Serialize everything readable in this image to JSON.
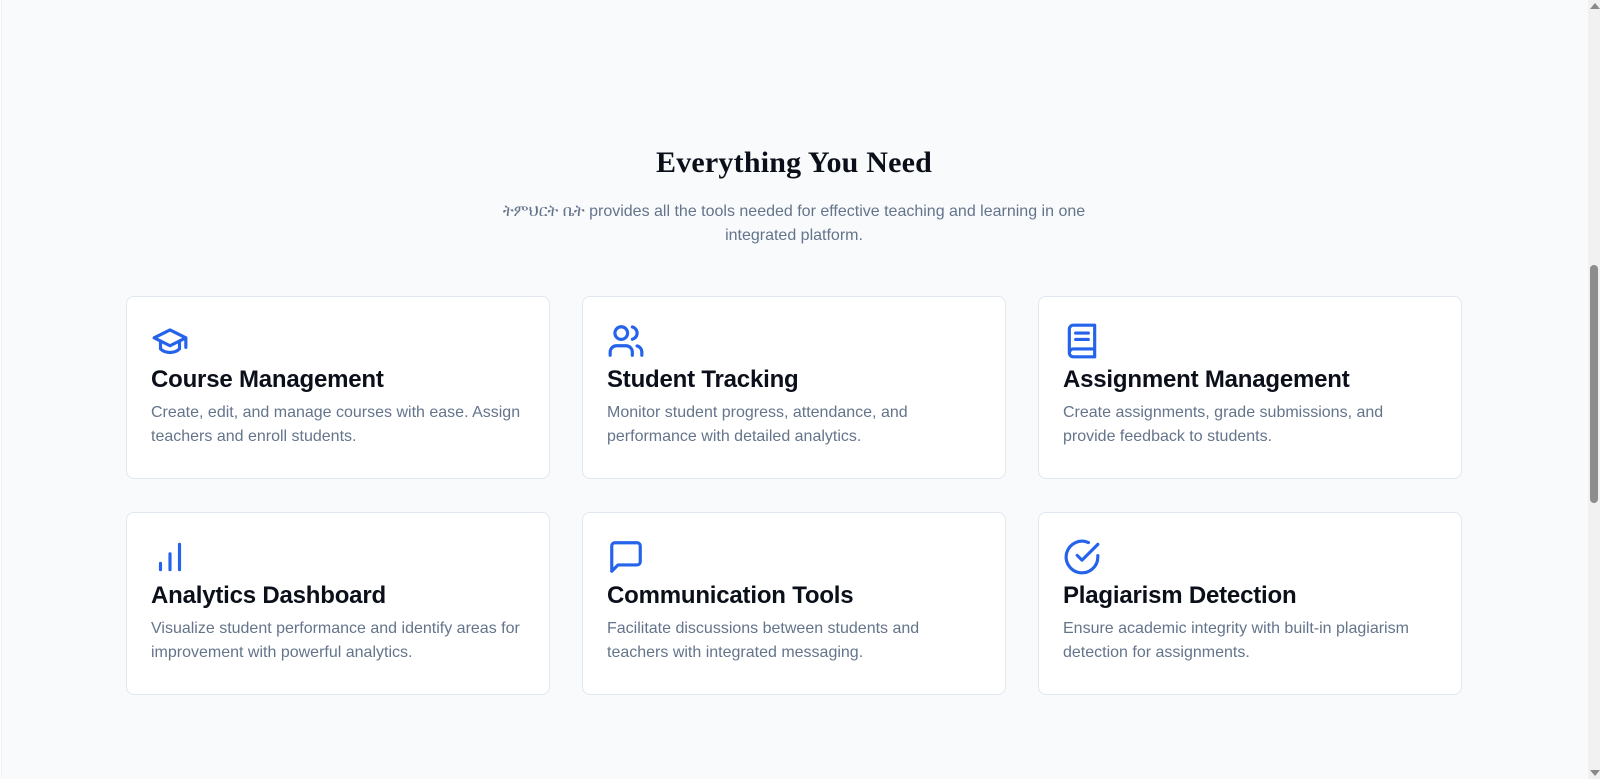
{
  "section": {
    "title": "Everything You Need",
    "subtitle": "ትምህርት ቤት provides all the tools needed for effective teaching and learning in one integrated platform."
  },
  "features": [
    {
      "icon": "graduation-cap-icon",
      "title": "Course Management",
      "description": "Create, edit, and manage courses with ease. Assign teachers and enroll students."
    },
    {
      "icon": "users-icon",
      "title": "Student Tracking",
      "description": "Monitor student progress, attendance, and performance with detailed analytics."
    },
    {
      "icon": "book-icon",
      "title": "Assignment Management",
      "description": "Create assignments, grade submissions, and provide feedback to students."
    },
    {
      "icon": "bar-chart-icon",
      "title": "Analytics Dashboard",
      "description": "Visualize student performance and identify areas for improvement with powerful analytics."
    },
    {
      "icon": "message-square-icon",
      "title": "Communication Tools",
      "description": "Facilitate discussions between students and teachers with integrated messaging."
    },
    {
      "icon": "check-circle-icon",
      "title": "Plagiarism Detection",
      "description": "Ensure academic integrity with built-in plagiarism detection for assignments."
    }
  ],
  "colors": {
    "accent": "#2563eb",
    "heading": "#0b0f19",
    "muted_text": "#64748b",
    "card_border": "#e2e8f0",
    "background": "#f8fafc"
  }
}
